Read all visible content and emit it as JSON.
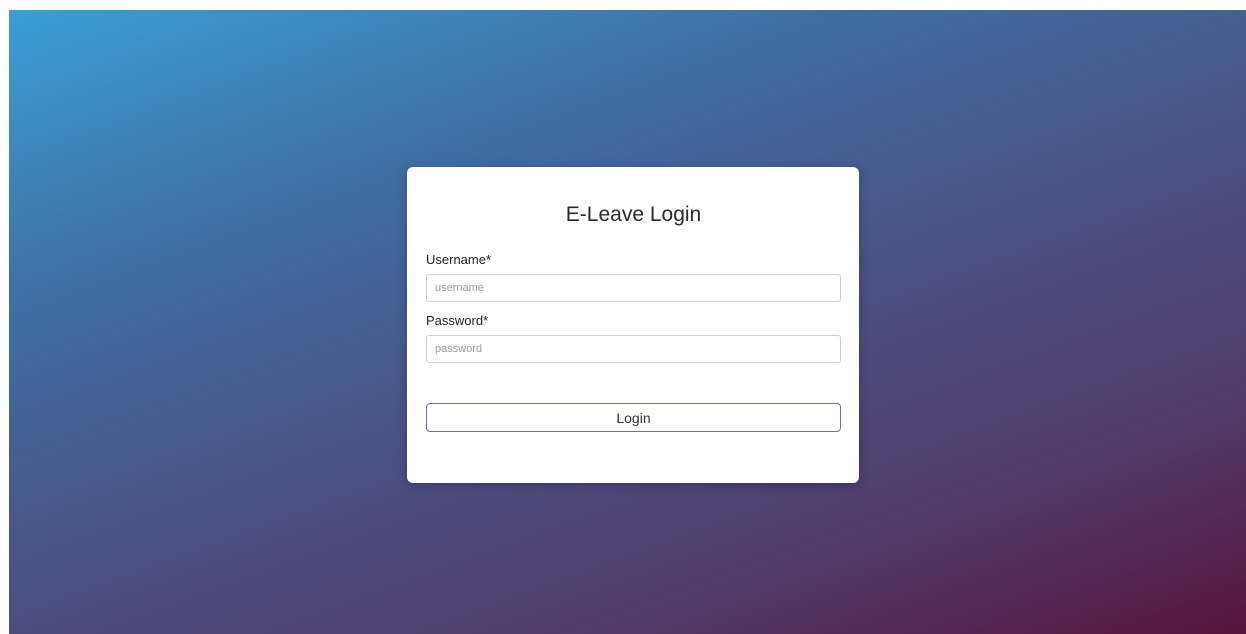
{
  "login": {
    "title": "E-Leave Login",
    "username_label": "Username*",
    "username_placeholder": "username",
    "username_value": "",
    "password_label": "Password*",
    "password_placeholder": "password",
    "password_value": "",
    "submit_label": "Login"
  },
  "colors": {
    "gradient_start": "#3a9fd6",
    "gradient_end": "#57143d",
    "card": "#ffffff",
    "button_border": "#6f6cc4"
  }
}
